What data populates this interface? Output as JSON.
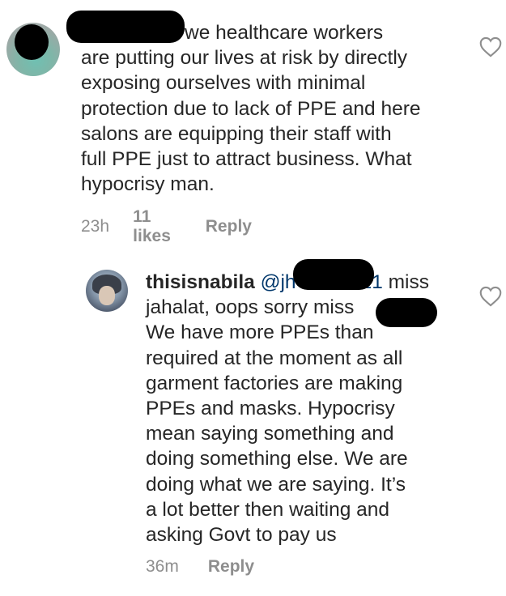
{
  "comments": [
    {
      "text_lines": [
        "          1 Lol we healthcare workers",
        "are putting our lives at risk by directly",
        "exposing ourselves with minimal",
        "protection due to lack of PPE and here",
        "salons are equipping their staff with",
        "full PPE just to attract business. What",
        "hypocrisy man."
      ],
      "time": "23h",
      "likes": "11 likes",
      "reply_label": "Reply",
      "like_icon": "heart-outline-icon"
    },
    {
      "username": "thisisnabila",
      "mention": "@jh",
      "mention_tail": "21",
      "line1_rest": " miss",
      "line2": "jahalat, oops sorry miss",
      "text_lines": [
        "We have more PPEs than",
        "required at the moment as all",
        "garment factories are making",
        "PPEs and masks. Hypocrisy",
        "mean saying something and",
        "doing something else. We are",
        "doing what we are saying. It’s",
        "a lot better then waiting and",
        "asking Govt to pay us"
      ],
      "time": "36m",
      "reply_label": "Reply",
      "like_icon": "heart-outline-icon"
    }
  ]
}
